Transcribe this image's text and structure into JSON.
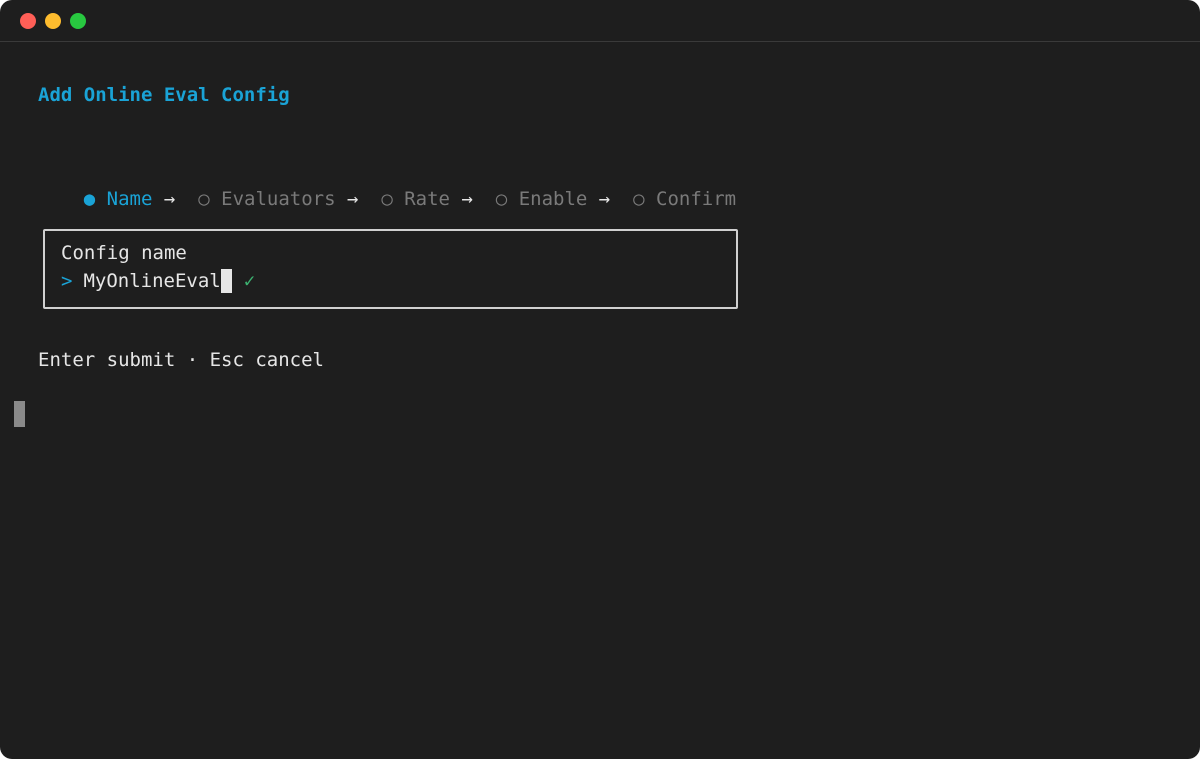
{
  "window": {
    "controls": [
      "close",
      "minimize",
      "zoom"
    ]
  },
  "form": {
    "title": "Add Online Eval Config",
    "steps": [
      {
        "label": "Name",
        "marker": "●",
        "active": true
      },
      {
        "label": "Evaluators",
        "marker": "○",
        "active": false
      },
      {
        "label": "Rate",
        "marker": "○",
        "active": false
      },
      {
        "label": "Enable",
        "marker": "○",
        "active": false
      },
      {
        "label": "Confirm",
        "marker": "○",
        "active": false
      }
    ],
    "arrow": "→",
    "field": {
      "label": "Config name",
      "prompt": ">",
      "value": "MyOnlineEval",
      "valid_mark": "✓"
    },
    "hint": "Enter submit · Esc cancel"
  },
  "colors": {
    "accent": "#1aa3d6",
    "valid": "#3cb371",
    "muted": "#7a7a7a",
    "background": "#1e1e1e"
  }
}
